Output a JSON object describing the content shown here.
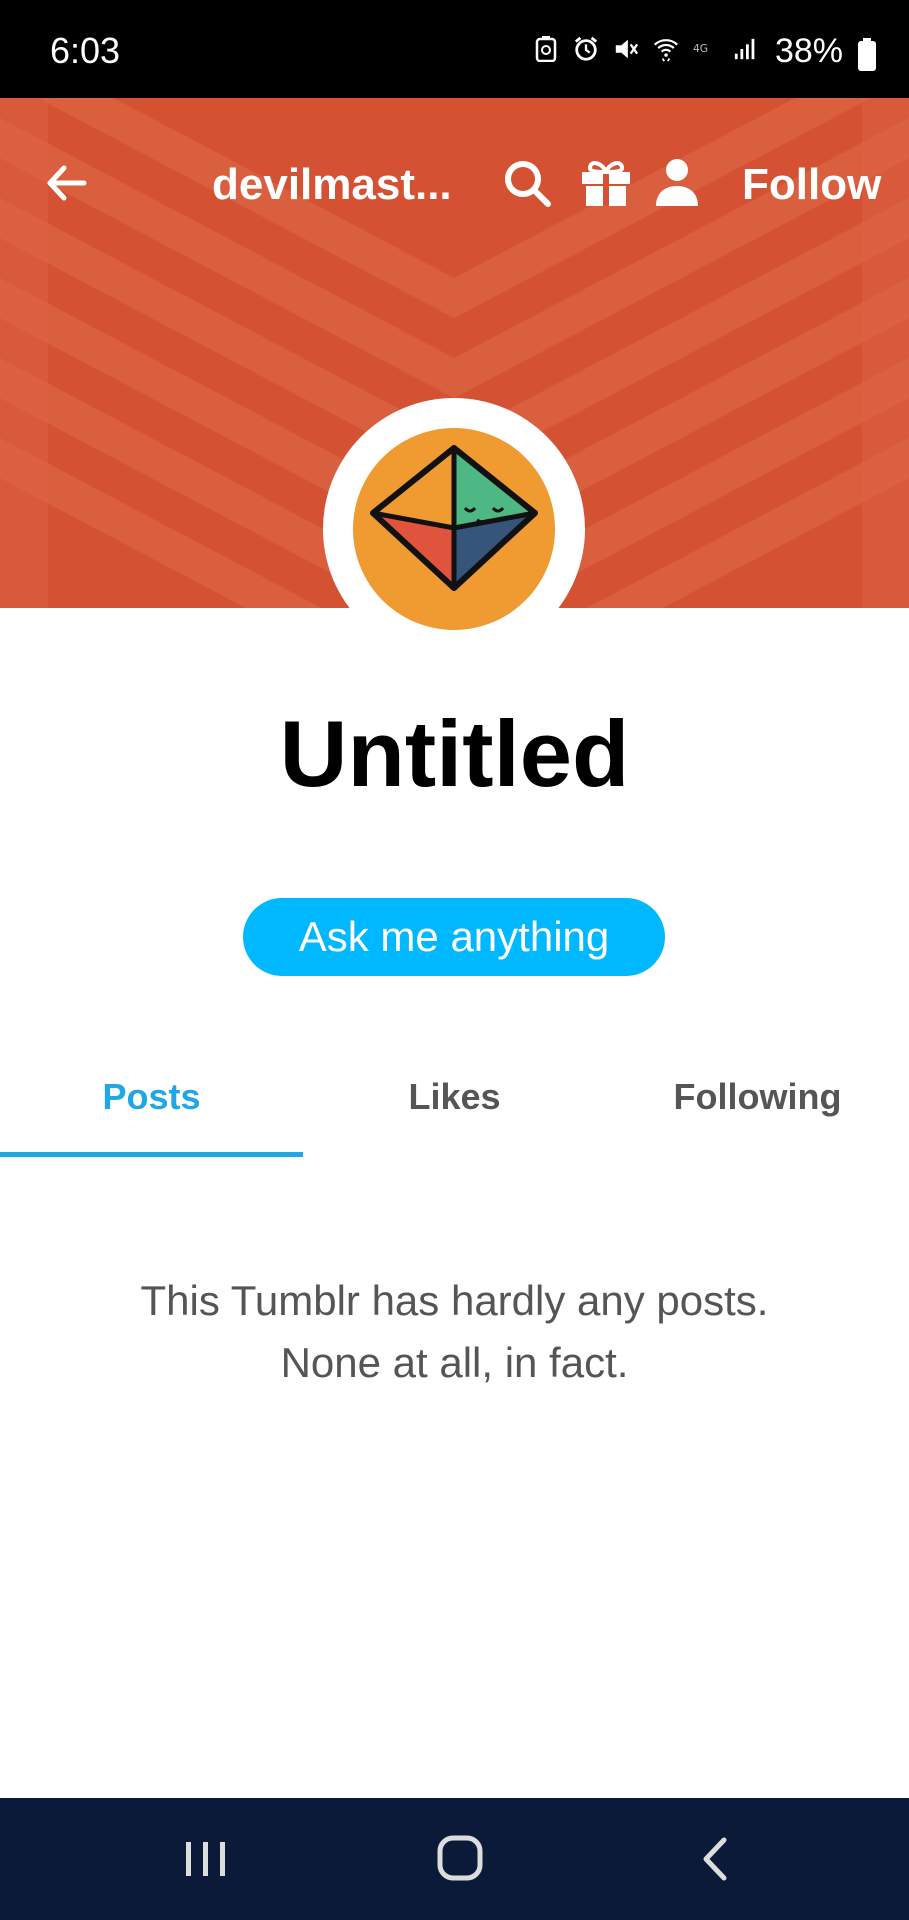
{
  "status_bar": {
    "time": "6:03",
    "battery_text": "38%",
    "icons": [
      "battery-saver-icon",
      "alarm-icon",
      "mute-icon",
      "wifi-icon",
      "4g-icon",
      "signal-icon",
      "battery-icon"
    ]
  },
  "header": {
    "blog_name": "devilmast...",
    "follow_label": "Follow",
    "banner_color": "#d45233",
    "icons": [
      "back-arrow-icon",
      "search-icon",
      "gift-icon",
      "user-icon"
    ]
  },
  "profile": {
    "title": "Untitled",
    "avatar_color": "#f09a32",
    "ask_button_label": "Ask me anything",
    "accent_color": "#00b8ff"
  },
  "tabs": [
    {
      "label": "Posts",
      "active": true
    },
    {
      "label": "Likes",
      "active": false
    },
    {
      "label": "Following",
      "active": false
    }
  ],
  "empty_state": {
    "line1": "This Tumblr has hardly any posts.",
    "line2": "None at all, in fact."
  },
  "nav_bar": {
    "icons": [
      "recents-icon",
      "home-icon",
      "back-icon"
    ]
  }
}
